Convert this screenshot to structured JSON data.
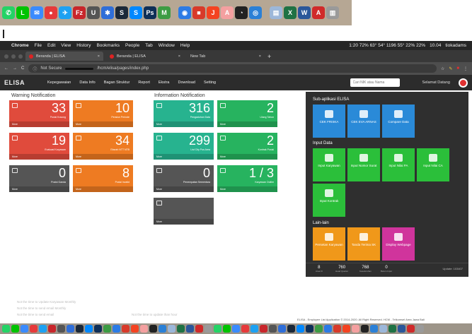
{
  "top_dock": {
    "icons": [
      {
        "name": "whatsapp-icon",
        "color": "#25d366",
        "glyph": "✆"
      },
      {
        "name": "line-icon",
        "color": "#00c300",
        "glyph": "L"
      },
      {
        "name": "messages-icon",
        "color": "#3a8bff",
        "glyph": "✉"
      },
      {
        "name": "camera-icon",
        "color": "#e63a3a",
        "glyph": "●"
      },
      {
        "name": "twitter-icon",
        "color": "#1da1f2",
        "glyph": "✈"
      },
      {
        "name": "filezilla-icon",
        "color": "#c8262b",
        "glyph": "Fz"
      },
      {
        "name": "utility-icon",
        "color": "#555555",
        "glyph": "U"
      },
      {
        "name": "bluetooth-icon",
        "color": "#2f6ed8",
        "glyph": "✱"
      },
      {
        "name": "steam-icon",
        "color": "#1b2838",
        "glyph": "S"
      },
      {
        "name": "shazam-icon",
        "color": "#0088ff",
        "glyph": "S"
      },
      {
        "name": "photoshop-icon",
        "color": "#0f2f57",
        "glyph": "Ps"
      },
      {
        "name": "maps-icon",
        "color": "#3d9c43",
        "glyph": "M"
      },
      {
        "name": "globe-icon",
        "color": "#2c7be5",
        "glyph": "◉"
      },
      {
        "name": "app-icon-red",
        "color": "#d83a2a",
        "glyph": "■"
      },
      {
        "name": "joomla-icon",
        "color": "#f44321",
        "glyph": "J"
      },
      {
        "name": "acrobat-icon",
        "color": "#f4a0a0",
        "glyph": "A"
      },
      {
        "name": "gauge-icon",
        "color": "#222222",
        "glyph": "◔"
      },
      {
        "name": "compass-icon",
        "color": "#2b80d6",
        "glyph": "◎"
      },
      {
        "name": "preview-icon",
        "color": "#9cb7d9",
        "glyph": "▤"
      },
      {
        "name": "excel-icon",
        "color": "#1f7244",
        "glyph": "X"
      },
      {
        "name": "word-icon",
        "color": "#2b579a",
        "glyph": "W"
      },
      {
        "name": "pdf-icon",
        "color": "#d02a2a",
        "glyph": "A"
      },
      {
        "name": "trash-icon",
        "color": "#9a9a9a",
        "glyph": "▥"
      }
    ]
  },
  "menubar": {
    "app_name": "Chrome",
    "menus": [
      "File",
      "Edit",
      "View",
      "History",
      "Bookmarks",
      "People",
      "Tab",
      "Window",
      "Help"
    ],
    "status": "1:20  72%   63° 54°  1196 55°  22%  22%",
    "clock": "10.04",
    "user": "tiokadams"
  },
  "tabs": [
    {
      "title": "Beranda | ELISA",
      "active": true
    },
    {
      "title": "Beranda | ELISA",
      "active": false
    },
    {
      "title": "New Tab",
      "active": false
    }
  ],
  "address": {
    "security": "Not Secure",
    "url": "/hcm/elisa/pages/index.php"
  },
  "appnav": {
    "logo": "ELISA",
    "items": [
      "Kepegawaian",
      "Data Info",
      "Bagan Struktur",
      "Report",
      "Ekstra",
      "Download",
      "Setting"
    ],
    "search_placeholder": "Cari NIK atau Nama",
    "welcome": "Selamat Datang"
  },
  "warning": {
    "title": "Warning Notification",
    "tiles": [
      {
        "num": "33",
        "label": "Posisi Kosong",
        "color": "#e04b3c"
      },
      {
        "num": "10",
        "label": "Pensiun Periode",
        "color": "#ee7b22"
      },
      {
        "num": "19",
        "label": "Evaluasi Karyawan",
        "color": "#e04b3c"
      },
      {
        "num": "34",
        "label": "Eksrah NTT NTB",
        "color": "#ee7b22"
      },
      {
        "num": "0",
        "label": "Posisi Ganda",
        "color": "#555555"
      },
      {
        "num": "8",
        "label": "Posisi Invalid",
        "color": "#ee7b22"
      }
    ]
  },
  "information": {
    "title": "Information Notification",
    "tiles": [
      {
        "num": "316",
        "label": "Pengaduhan Data",
        "color": "#27b38f"
      },
      {
        "num": "2",
        "label": "Ulang Tahun",
        "color": "#27b35f"
      },
      {
        "num": "299",
        "label": "List City Pos Area",
        "color": "#27b38f"
      },
      {
        "num": "2",
        "label": "Kontrak Posisi",
        "color": "#27b35f"
      },
      {
        "num": "0",
        "label": "Penempatan Sementara",
        "color": "#555555"
      },
      {
        "num": "1 / 3",
        "label": "Karyawan Outlim",
        "color": "#27b35f"
      },
      {
        "num": "",
        "label": "",
        "color": "#555555"
      }
    ]
  },
  "more_label": "More",
  "panel": {
    "title": "Sub-aplikasi ELISA",
    "sub_apps": [
      {
        "label": "CEK FRISKA",
        "color": "#2a8ad8"
      },
      {
        "label": "CEK EVA ARNAS",
        "color": "#2a8ad8"
      },
      {
        "label": "Compare Data",
        "color": "#2a8ad8"
      }
    ],
    "input_title": "Input Data",
    "inputs": [
      {
        "label": "Input Karyawan",
        "color": "#2bbf3a"
      },
      {
        "label": "Input Nomor Surat",
        "color": "#2bbf3a"
      },
      {
        "label": "Input Nilai PA",
        "color": "#2bbf3a"
      },
      {
        "label": "Input Nilai CA",
        "color": "#2bbf3a"
      },
      {
        "label": "Input Kontrak",
        "color": "#2bbf3a"
      }
    ],
    "lain_title": "Lain-lain",
    "lain": [
      {
        "label": "Persetan Karyawan",
        "color": "#f0981a"
      },
      {
        "label": "Tanda Terima SK",
        "color": "#f0981a"
      },
      {
        "label": "Display Webpage",
        "color": "#d0349c"
      }
    ],
    "stats": [
      {
        "v": "8",
        "l": "Area III"
      },
      {
        "v": "760",
        "l": "Head Quarter"
      },
      {
        "v": "768",
        "l": "Keseluruhan"
      },
      {
        "v": "0",
        "l": "Belum Input"
      }
    ],
    "update": "Update: 103407"
  },
  "faint_notes": [
    "Not the time to Update Karyawan Monthly",
    "Not the time to send email Monthly",
    "Not the time to send email",
    "Not the time to update than hour"
  ],
  "footer": "ELISA - Employee List Application © 2014-2020. All Right Reserved. HCM - Telkomsel Area Jawa Bali"
}
